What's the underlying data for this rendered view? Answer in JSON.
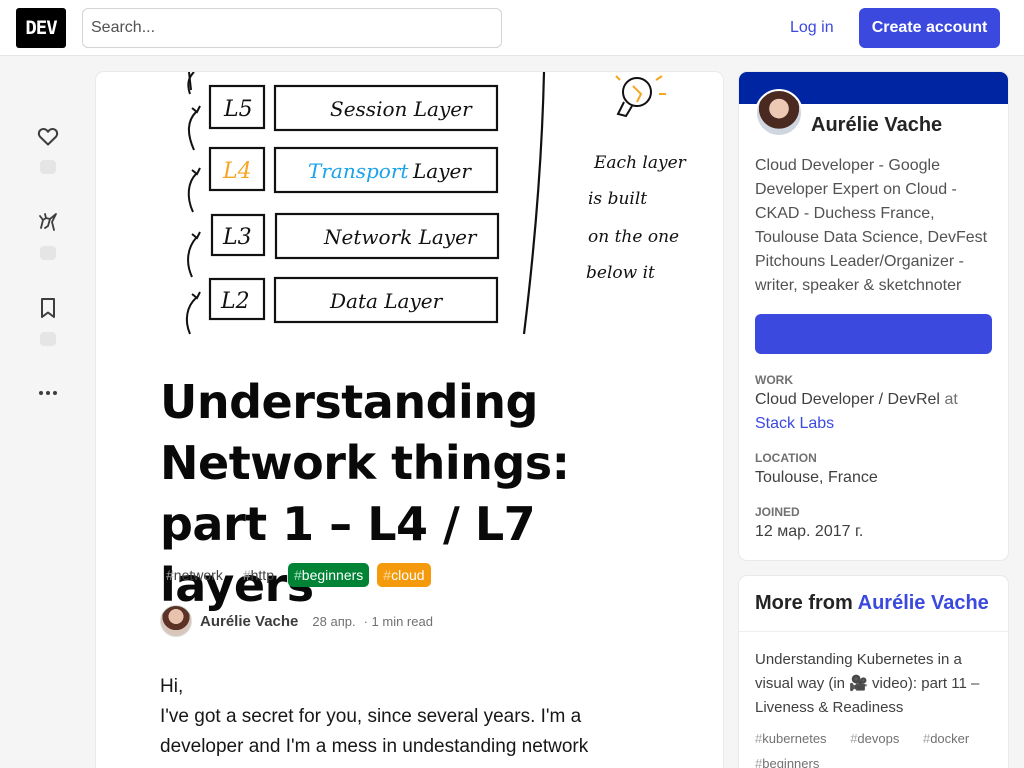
{
  "header": {
    "logo": "DEV",
    "search_placeholder": "Search...",
    "login": "Log in",
    "create_account": "Create account"
  },
  "rail": {
    "icons": [
      "heart-icon",
      "unicorn-icon",
      "bookmark-icon",
      "more-options-icon"
    ]
  },
  "cover": {
    "layers": [
      {
        "id": "L5",
        "name": "Session Layer"
      },
      {
        "id": "L4",
        "name": "Transport Layer",
        "highlight": "Transport"
      },
      {
        "id": "L3",
        "name": "Network Layer"
      },
      {
        "id": "L2",
        "name": "Data Layer"
      }
    ],
    "note_lines": [
      "Each layer",
      "is built",
      "on the one",
      "below it"
    ],
    "colors": {
      "highlight_blue": "#1aa3e8",
      "highlight_orange": "#f5a623"
    }
  },
  "article": {
    "title": "Understanding Network things: part 1 – L4 / L7 layers",
    "tags": [
      {
        "hash": "#",
        "name": "network",
        "style": "plain"
      },
      {
        "hash": "#",
        "name": "http",
        "style": "plain"
      },
      {
        "hash": "#",
        "name": "beginners",
        "style": "green"
      },
      {
        "hash": "#",
        "name": "cloud",
        "style": "orange"
      }
    ],
    "author": "Aurélie Vache",
    "date": "28 апр.",
    "read_time": "· 1 min read",
    "body": "Hi,\nI've got a secret for you, since several years. I'm a developer and I'm a mess in undestanding network things..."
  },
  "profile": {
    "name": "Aurélie Vache",
    "bio": "Cloud Developer - Google Developer Expert on Cloud - CKAD - Duchess France, Toulouse Data Science, DevFest Pitchouns Leader/Organizer - writer, speaker & sketchnoter",
    "work_label": "Work",
    "work_role": "Cloud Developer / DevRel",
    "work_at": "at",
    "work_company": "Stack Labs",
    "location_label": "Location",
    "location": "Toulouse, France",
    "joined_label": "Joined",
    "joined": "12 мар. 2017 г.",
    "brand_color": "#0025a3"
  },
  "more_from": {
    "prefix": "More from",
    "author": "Aurélie Vache",
    "item_title": "Understanding Kubernetes in a visual way (in 🎥 video): part 11 – Liveness & Readiness",
    "item_tags": [
      "kubernetes",
      "devops",
      "docker",
      "beginners"
    ]
  }
}
